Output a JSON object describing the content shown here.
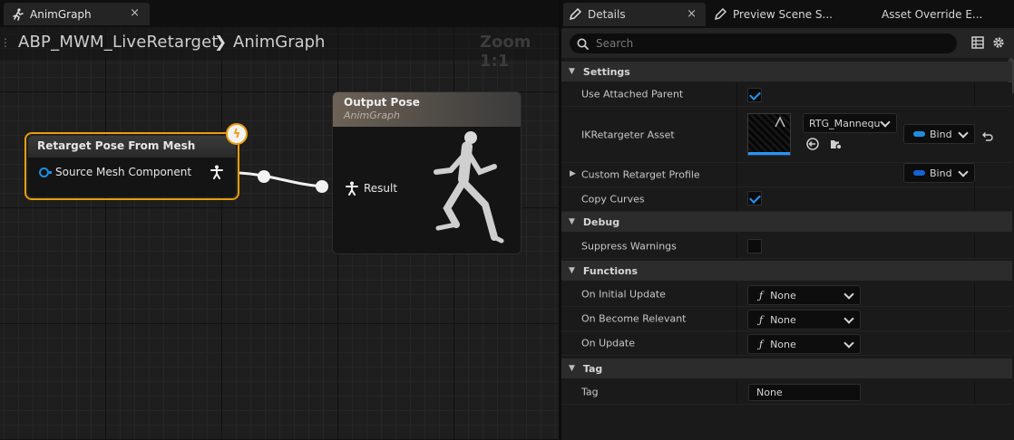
{
  "graph_tab": {
    "label": "AnimGraph",
    "close": "×"
  },
  "breadcrumb": {
    "dots": "⋮",
    "path1": "ABP_MWM_LiveRetarget",
    "separator": "❯",
    "path2": "AnimGraph"
  },
  "zoom": "Zoom 1:1",
  "node_source": {
    "title": "Retarget Pose From Mesh",
    "pin": "Source Mesh Component"
  },
  "node_output": {
    "title": "Output Pose",
    "subtitle": "AnimGraph",
    "pin": "Result"
  },
  "right_tabs": [
    {
      "label": "Details",
      "close": "×"
    },
    {
      "label": "Preview Scene S..."
    },
    {
      "label": "Asset Override E..."
    }
  ],
  "search": {
    "placeholder": "Search"
  },
  "sections": {
    "settings": "Settings",
    "debug": "Debug",
    "functions": "Functions",
    "tag": "Tag"
  },
  "props": {
    "use_attached_parent": "Use Attached Parent",
    "ik_asset": "IKRetargeter Asset",
    "ik_asset_value": "RTG_Mannequ",
    "custom_profile": "Custom Retarget Profile",
    "copy_curves": "Copy Curves",
    "suppress_warnings": "Suppress Warnings",
    "on_initial_update": "On Initial Update",
    "on_become_relevant": "On Become Relevant",
    "on_update": "On Update",
    "tag": "Tag",
    "tag_value": "None"
  },
  "bind_label": "Bind",
  "func_none": "None",
  "checks": {
    "use_attached_parent": true,
    "copy_curves": true,
    "suppress_warnings": false
  },
  "colors": {
    "selection_orange": "#e89e0c",
    "accent_blue": "#2596ff",
    "bind_blue": "#1c8fe3"
  }
}
